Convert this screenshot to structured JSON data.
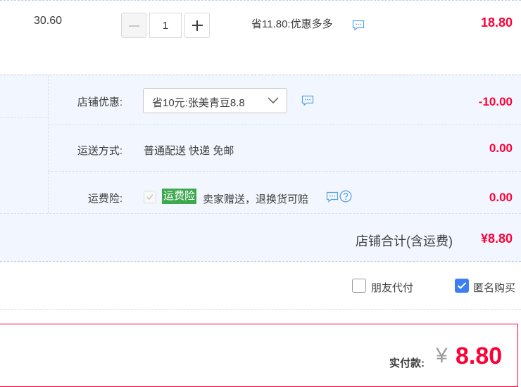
{
  "item": {
    "unit_price": "30.60",
    "quantity": "1",
    "promo": "省11.80:优惠多多",
    "subtotal": "18.80"
  },
  "shop": {
    "discount_label": "店铺优惠:",
    "discount_selected": "省10元:张美青豆8.8",
    "discount_amount": "-10.00",
    "shipping_label": "运送方式:",
    "shipping_value": "普通配送 快递 免邮",
    "shipping_amount": "0.00",
    "insurance_label": "运费险:",
    "insurance_badge": "运费险",
    "insurance_desc": "卖家赠送，退换货可赔",
    "insurance_amount": "0.00",
    "total_label": "店铺合计(含运费)",
    "total_value": "¥8.80"
  },
  "options": {
    "friend_pay_label": "朋友代付",
    "friend_pay_checked": false,
    "anonymous_label": "匿名购买",
    "anonymous_checked": true
  },
  "payment": {
    "label": "实付款:",
    "currency": "¥",
    "amount": "8.80"
  },
  "colors": {
    "price_red": "#ff0036",
    "panel_bg": "#f2f7ff",
    "insurance_green": "#3ea84f",
    "checkbox_blue": "#3b7ff3",
    "chat_icon_blue": "#5aa2e6"
  },
  "icons": [
    "minus-icon",
    "plus-icon",
    "chat-bubble-icon",
    "chevron-down-icon",
    "checkmark-icon",
    "help-circle-icon"
  ]
}
